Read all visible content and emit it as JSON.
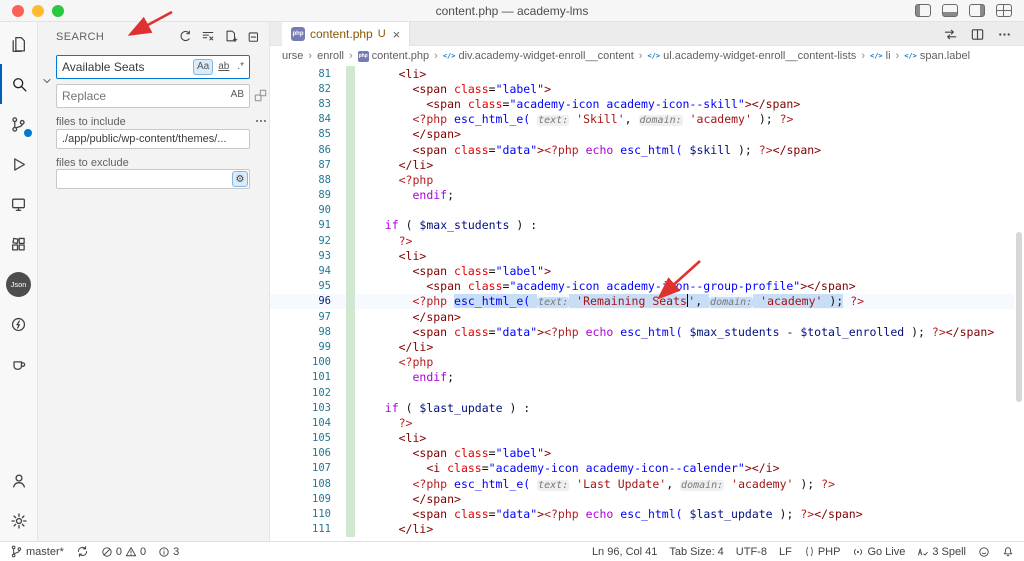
{
  "title_bar": {
    "title": "content.php — academy-lms"
  },
  "activity_bar": {
    "json_badge": "Json"
  },
  "colors": {
    "accent": "#0078d4",
    "annotation_arrow": "#e03131",
    "added_gutter": "#cfe8cf",
    "tab_git": "#895503"
  },
  "sidebar": {
    "header": "SEARCH",
    "search": {
      "value": "Available Seats",
      "match_case": "Aa",
      "whole_word": "ab",
      "regex": ".*"
    },
    "replace": {
      "placeholder": "Replace",
      "preserve_case": "AB"
    },
    "include": {
      "label": "files to include",
      "value": "./app/public/wp-content/themes/..."
    },
    "exclude": {
      "label": "files to exclude",
      "value": ""
    }
  },
  "editor": {
    "tab": {
      "name": "content.php",
      "git_status": "U",
      "close": "×"
    },
    "breadcrumbs": [
      {
        "label": "urse"
      },
      {
        "label": "enroll"
      },
      {
        "label": "content.php",
        "icon": "php"
      },
      {
        "label": "div.academy-widget-enroll__content",
        "icon": "symbol"
      },
      {
        "label": "ul.academy-widget-enroll__content-lists",
        "icon": "symbol"
      },
      {
        "label": "li",
        "icon": "symbol"
      },
      {
        "label": "span.label",
        "icon": "symbol"
      }
    ],
    "lines": [
      {
        "n": 81,
        "t": [
          [
            "     ",
            "pln"
          ],
          [
            "<li>",
            "tag"
          ]
        ]
      },
      {
        "n": 82,
        "t": [
          [
            "       ",
            "pln"
          ],
          [
            "<span",
            "tag"
          ],
          [
            " ",
            "pln"
          ],
          [
            "class",
            "attr"
          ],
          [
            "=",
            "pln"
          ],
          [
            "\"label\"",
            "astr"
          ],
          [
            ">",
            "tag"
          ]
        ]
      },
      {
        "n": 83,
        "t": [
          [
            "         ",
            "pln"
          ],
          [
            "<span",
            "tag"
          ],
          [
            " ",
            "pln"
          ],
          [
            "class",
            "attr"
          ],
          [
            "=",
            "pln"
          ],
          [
            "\"academy-icon academy-icon--skill\"",
            "astr"
          ],
          [
            ">",
            "tag"
          ],
          [
            "</span>",
            "tag"
          ]
        ]
      },
      {
        "n": 84,
        "t": [
          [
            "       ",
            "pln"
          ],
          [
            "<?php ",
            "php"
          ],
          [
            "esc_html_e(",
            "fn"
          ],
          [
            " ",
            "pln"
          ],
          [
            "text:",
            "inlay"
          ],
          [
            " ",
            "pln"
          ],
          [
            "'Skill'",
            "str"
          ],
          [
            ", ",
            "pln"
          ],
          [
            "domain:",
            "inlay"
          ],
          [
            " ",
            "pln"
          ],
          [
            "'academy'",
            "str"
          ],
          [
            " );",
            "pln"
          ],
          [
            " ",
            "pln"
          ],
          [
            "?>",
            "php"
          ]
        ]
      },
      {
        "n": 85,
        "t": [
          [
            "       ",
            "pln"
          ],
          [
            "</span>",
            "tag"
          ]
        ]
      },
      {
        "n": 86,
        "t": [
          [
            "       ",
            "pln"
          ],
          [
            "<span",
            "tag"
          ],
          [
            " ",
            "pln"
          ],
          [
            "class",
            "attr"
          ],
          [
            "=",
            "pln"
          ],
          [
            "\"data\"",
            "astr"
          ],
          [
            ">",
            "tag"
          ],
          [
            "<?php ",
            "php"
          ],
          [
            "echo",
            "kw"
          ],
          [
            " ",
            "pln"
          ],
          [
            "esc_html(",
            "fn"
          ],
          [
            " ",
            "pln"
          ],
          [
            "$skill",
            "var"
          ],
          [
            " );",
            "pln"
          ],
          [
            " ",
            "pln"
          ],
          [
            "?>",
            "php"
          ],
          [
            "</span>",
            "tag"
          ]
        ]
      },
      {
        "n": 87,
        "t": [
          [
            "     ",
            "pln"
          ],
          [
            "</li>",
            "tag"
          ]
        ]
      },
      {
        "n": 88,
        "t": [
          [
            "     ",
            "pln"
          ],
          [
            "<?php",
            "php"
          ]
        ]
      },
      {
        "n": 89,
        "t": [
          [
            "       ",
            "pln"
          ],
          [
            "endif",
            "kw"
          ],
          [
            ";",
            "pln"
          ]
        ]
      },
      {
        "n": 90,
        "t": []
      },
      {
        "n": 91,
        "t": [
          [
            "   ",
            "pln"
          ],
          [
            "if",
            "kw"
          ],
          [
            " ( ",
            "pln"
          ],
          [
            "$max_students",
            "var"
          ],
          [
            " ) :",
            "pln"
          ]
        ]
      },
      {
        "n": 92,
        "t": [
          [
            "     ",
            "pln"
          ],
          [
            "?>",
            "php"
          ]
        ]
      },
      {
        "n": 93,
        "t": [
          [
            "     ",
            "pln"
          ],
          [
            "<li>",
            "tag"
          ]
        ]
      },
      {
        "n": 94,
        "t": [
          [
            "       ",
            "pln"
          ],
          [
            "<span",
            "tag"
          ],
          [
            " ",
            "pln"
          ],
          [
            "class",
            "attr"
          ],
          [
            "=",
            "pln"
          ],
          [
            "\"label\"",
            "astr"
          ],
          [
            ">",
            "tag"
          ]
        ]
      },
      {
        "n": 95,
        "t": [
          [
            "         ",
            "pln"
          ],
          [
            "<span",
            "tag"
          ],
          [
            " ",
            "pln"
          ],
          [
            "class",
            "attr"
          ],
          [
            "=",
            "pln"
          ],
          [
            "\"academy-icon academy-icon--group-profile\"",
            "astr"
          ],
          [
            ">",
            "tag"
          ],
          [
            "</span>",
            "tag"
          ]
        ]
      },
      {
        "n": 96,
        "cur": true,
        "t": [
          [
            "       ",
            "pln"
          ],
          [
            "<?php ",
            "php"
          ],
          [
            "esc_html_e(",
            "fn",
            1
          ],
          [
            " ",
            "pln",
            1
          ],
          [
            "text:",
            "inlay",
            1
          ],
          [
            " ",
            "pln",
            1
          ],
          [
            "'Remaining Seats",
            "str",
            1
          ],
          [
            "",
            "cursor"
          ],
          [
            "'",
            "str",
            1
          ],
          [
            ", ",
            "pln",
            1
          ],
          [
            "domain:",
            "inlay",
            1
          ],
          [
            " ",
            "pln",
            1
          ],
          [
            "'academy'",
            "str",
            1
          ],
          [
            " );",
            "pln",
            1
          ],
          [
            " ",
            "pln"
          ],
          [
            "?>",
            "php"
          ]
        ]
      },
      {
        "n": 97,
        "t": [
          [
            "       ",
            "pln"
          ],
          [
            "</span>",
            "tag"
          ]
        ]
      },
      {
        "n": 98,
        "t": [
          [
            "       ",
            "pln"
          ],
          [
            "<span",
            "tag"
          ],
          [
            " ",
            "pln"
          ],
          [
            "class",
            "attr"
          ],
          [
            "=",
            "pln"
          ],
          [
            "\"data\"",
            "astr"
          ],
          [
            ">",
            "tag"
          ],
          [
            "<?php ",
            "php"
          ],
          [
            "echo",
            "kw"
          ],
          [
            " ",
            "pln"
          ],
          [
            "esc_html(",
            "fn"
          ],
          [
            " ",
            "pln"
          ],
          [
            "$max_students",
            "var"
          ],
          [
            " - ",
            "pln"
          ],
          [
            "$total_enrolled",
            "var"
          ],
          [
            " );",
            "pln"
          ],
          [
            " ",
            "pln"
          ],
          [
            "?>",
            "php"
          ],
          [
            "</span>",
            "tag"
          ]
        ]
      },
      {
        "n": 99,
        "t": [
          [
            "     ",
            "pln"
          ],
          [
            "</li>",
            "tag"
          ]
        ]
      },
      {
        "n": 100,
        "t": [
          [
            "     ",
            "pln"
          ],
          [
            "<?php",
            "php"
          ]
        ]
      },
      {
        "n": 101,
        "t": [
          [
            "       ",
            "pln"
          ],
          [
            "endif",
            "kw"
          ],
          [
            ";",
            "pln"
          ]
        ]
      },
      {
        "n": 102,
        "t": []
      },
      {
        "n": 103,
        "t": [
          [
            "   ",
            "pln"
          ],
          [
            "if",
            "kw"
          ],
          [
            " ( ",
            "pln"
          ],
          [
            "$last_update",
            "var"
          ],
          [
            " ) :",
            "pln"
          ]
        ]
      },
      {
        "n": 104,
        "t": [
          [
            "     ",
            "pln"
          ],
          [
            "?>",
            "php"
          ]
        ]
      },
      {
        "n": 105,
        "t": [
          [
            "     ",
            "pln"
          ],
          [
            "<li>",
            "tag"
          ]
        ]
      },
      {
        "n": 106,
        "t": [
          [
            "       ",
            "pln"
          ],
          [
            "<span",
            "tag"
          ],
          [
            " ",
            "pln"
          ],
          [
            "class",
            "attr"
          ],
          [
            "=",
            "pln"
          ],
          [
            "\"label\"",
            "astr"
          ],
          [
            ">",
            "tag"
          ]
        ]
      },
      {
        "n": 107,
        "t": [
          [
            "         ",
            "pln"
          ],
          [
            "<i",
            "tag"
          ],
          [
            " ",
            "pln"
          ],
          [
            "class",
            "attr"
          ],
          [
            "=",
            "pln"
          ],
          [
            "\"academy-icon academy-icon--calender\"",
            "astr"
          ],
          [
            ">",
            "tag"
          ],
          [
            "</i>",
            "tag"
          ]
        ]
      },
      {
        "n": 108,
        "t": [
          [
            "       ",
            "pln"
          ],
          [
            "<?php ",
            "php"
          ],
          [
            "esc_html_e(",
            "fn"
          ],
          [
            " ",
            "pln"
          ],
          [
            "text:",
            "inlay"
          ],
          [
            " ",
            "pln"
          ],
          [
            "'Last Update'",
            "str"
          ],
          [
            ", ",
            "pln"
          ],
          [
            "domain:",
            "inlay"
          ],
          [
            " ",
            "pln"
          ],
          [
            "'academy'",
            "str"
          ],
          [
            " );",
            "pln"
          ],
          [
            " ",
            "pln"
          ],
          [
            "?>",
            "php"
          ]
        ]
      },
      {
        "n": 109,
        "t": [
          [
            "       ",
            "pln"
          ],
          [
            "</span>",
            "tag"
          ]
        ]
      },
      {
        "n": 110,
        "t": [
          [
            "       ",
            "pln"
          ],
          [
            "<span",
            "tag"
          ],
          [
            " ",
            "pln"
          ],
          [
            "class",
            "attr"
          ],
          [
            "=",
            "pln"
          ],
          [
            "\"data\"",
            "astr"
          ],
          [
            ">",
            "tag"
          ],
          [
            "<?php ",
            "php"
          ],
          [
            "echo",
            "kw"
          ],
          [
            " ",
            "pln"
          ],
          [
            "esc_html(",
            "fn"
          ],
          [
            " ",
            "pln"
          ],
          [
            "$last_update",
            "var"
          ],
          [
            " );",
            "pln"
          ],
          [
            " ",
            "pln"
          ],
          [
            "?>",
            "php"
          ],
          [
            "</span>",
            "tag"
          ]
        ]
      },
      {
        "n": 111,
        "t": [
          [
            "     ",
            "pln"
          ],
          [
            "</li>",
            "tag"
          ]
        ]
      }
    ]
  },
  "status_bar": {
    "branch": "master*",
    "errors": "0",
    "warnings": "0",
    "extra": "3",
    "line_col": "Ln 96, Col 41",
    "tab_size": "Tab Size: 4",
    "encoding": "UTF-8",
    "eol": "LF",
    "language": "PHP",
    "go_live": "Go Live",
    "spell": "3 Spell"
  }
}
